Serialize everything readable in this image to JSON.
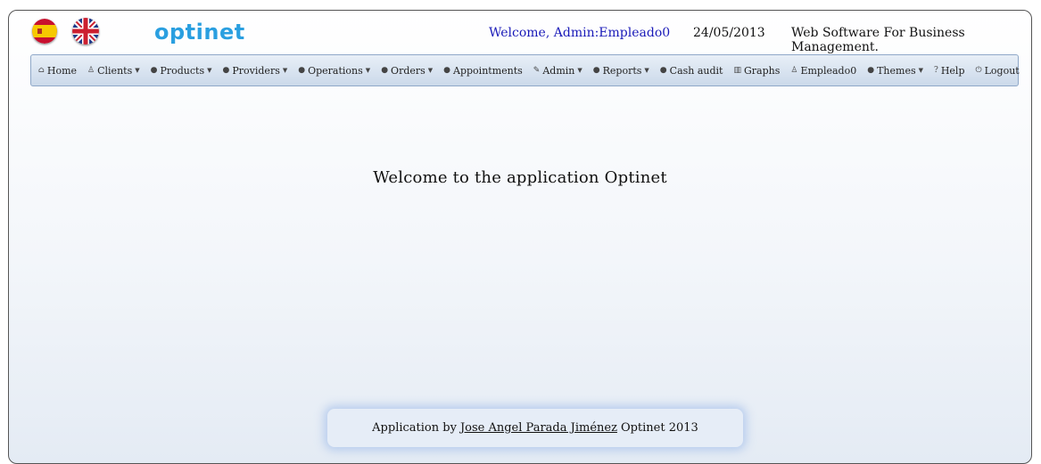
{
  "header": {
    "logo": "optinet",
    "welcome": "Welcome, Admin:Empleado0",
    "date": "24/05/2013",
    "tagline": "Web Software For Business Management."
  },
  "menu": {
    "items": [
      {
        "label": "Home",
        "icon": "home-icon",
        "dropdown": false
      },
      {
        "label": "Clients",
        "icon": "user-icon",
        "dropdown": true
      },
      {
        "label": "Products",
        "icon": "bullet-icon",
        "dropdown": true
      },
      {
        "label": "Providers",
        "icon": "bullet-icon",
        "dropdown": true
      },
      {
        "label": "Operations",
        "icon": "bullet-icon",
        "dropdown": true
      },
      {
        "label": "Orders",
        "icon": "bullet-icon",
        "dropdown": true
      },
      {
        "label": "Appointments",
        "icon": "bullet-icon",
        "dropdown": false
      },
      {
        "label": "Admin",
        "icon": "wrench-icon",
        "dropdown": true
      },
      {
        "label": "Reports",
        "icon": "bullet-icon",
        "dropdown": true
      },
      {
        "label": "Cash audit",
        "icon": "bullet-icon",
        "dropdown": false
      },
      {
        "label": "Graphs",
        "icon": "chart-icon",
        "dropdown": false
      },
      {
        "label": "Empleado0",
        "icon": "user-icon",
        "dropdown": false
      },
      {
        "label": "Themes",
        "icon": "bullet-icon",
        "dropdown": true
      },
      {
        "label": "Help",
        "icon": "help-icon",
        "dropdown": false
      },
      {
        "label": "Logout",
        "icon": "power-icon",
        "dropdown": false
      }
    ]
  },
  "main": {
    "title": "Welcome to the application Optinet"
  },
  "footer": {
    "prefix": "Application by",
    "author_link": "Jose Angel Parada Jiménez",
    "suffix": "Optinet 2013"
  },
  "colors": {
    "logo": "#2a9fe0",
    "welcome": "#1a1ab8",
    "menubar_top": "#e8eff7",
    "menubar_bottom": "#cbd9ea"
  }
}
